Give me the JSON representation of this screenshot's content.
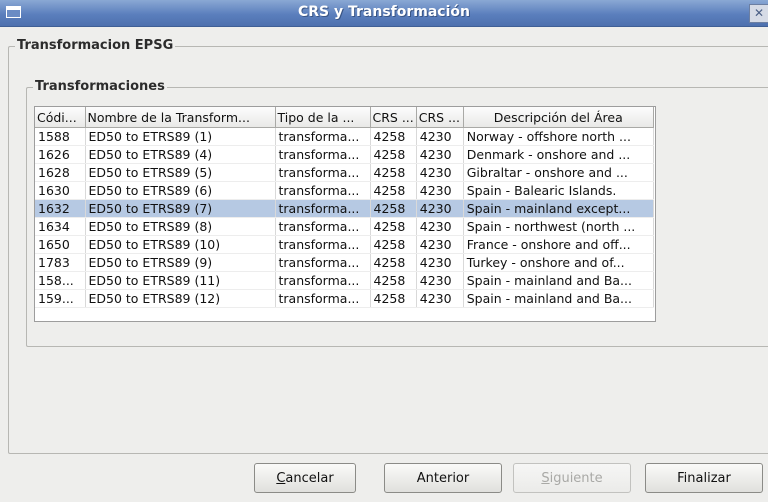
{
  "window": {
    "title": "CRS y Transformación",
    "close_glyph": "✕",
    "icons": {
      "window": "window-menu-icon",
      "close": "close-icon"
    }
  },
  "groups": {
    "outer_title": "Transformacion EPSG",
    "inner_title": "Transformaciones"
  },
  "table": {
    "columns": [
      "Códi...",
      "Nombre de la Transform...",
      "Tipo de la ...",
      "CRS ...",
      "CRS ...",
      "Descripción del Área"
    ],
    "rows": [
      [
        "1588",
        "ED50 to ETRS89 (1)",
        "transforma...",
        "4258",
        "4230",
        "Norway - offshore north ..."
      ],
      [
        "1626",
        "ED50 to ETRS89 (4)",
        "transforma...",
        "4258",
        "4230",
        "Denmark - onshore and ..."
      ],
      [
        "1628",
        "ED50 to ETRS89 (5)",
        "transforma...",
        "4258",
        "4230",
        "Gibraltar - onshore and ..."
      ],
      [
        "1630",
        "ED50 to ETRS89 (6)",
        "transforma...",
        "4258",
        "4230",
        "Spain - Balearic Islands."
      ],
      [
        "1632",
        "ED50 to ETRS89 (7)",
        "transforma...",
        "4258",
        "4230",
        "Spain - mainland except..."
      ],
      [
        "1634",
        "ED50 to ETRS89 (8)",
        "transforma...",
        "4258",
        "4230",
        "Spain - northwest (north ..."
      ],
      [
        "1650",
        "ED50 to ETRS89 (10)",
        "transforma...",
        "4258",
        "4230",
        "France - onshore and off..."
      ],
      [
        "1783",
        "ED50 to ETRS89 (9)",
        "transforma...",
        "4258",
        "4230",
        "Turkey - onshore and of..."
      ],
      [
        "158...",
        "ED50 to ETRS89 (11)",
        "transforma...",
        "4258",
        "4230",
        "Spain - mainland and Ba..."
      ],
      [
        "159...",
        "ED50 to ETRS89 (12)",
        "transforma...",
        "4258",
        "4230",
        "Spain - mainland and Ba..."
      ]
    ],
    "selected_index": 4
  },
  "buttons": {
    "cancel": {
      "first": "C",
      "rest": "ancelar"
    },
    "previous": "Anterior",
    "next": {
      "first": "S",
      "rest": "iguiente",
      "enabled": false
    },
    "finish": "Finalizar"
  }
}
